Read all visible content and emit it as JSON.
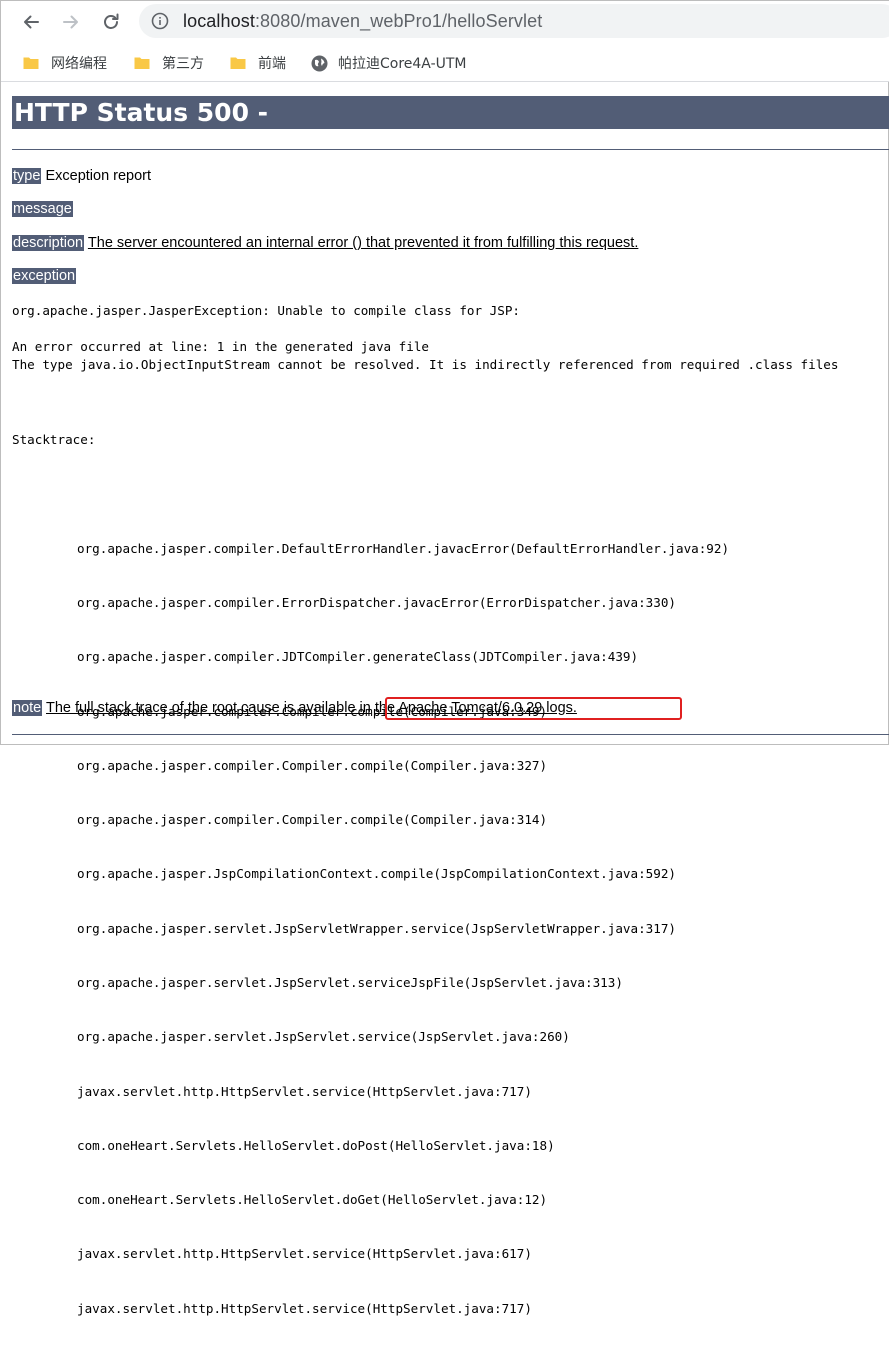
{
  "browser": {
    "url_host": "localhost",
    "url_rest": ":8080/maven_webPro1/helloServlet"
  },
  "bookmarks": [
    {
      "label": "网络编程",
      "icon": "folder-icon"
    },
    {
      "label": "第三方",
      "icon": "folder-icon"
    },
    {
      "label": "前端",
      "icon": "folder-icon"
    },
    {
      "label": "帕拉迪Core4A-UTM",
      "icon": "globe-icon"
    }
  ],
  "colors": {
    "tomcat_header": "#525d76",
    "highlight_box": "#e02020"
  },
  "page": {
    "title": "HTTP Status 500 -",
    "type_label": "type",
    "type_value": "Exception report",
    "message_label": "message",
    "description_label": "description",
    "description_value": "The server encountered an internal error () that prevented it from fulfilling this request.",
    "exception_label": "exception",
    "exception_line": "org.apache.jasper.JasperException: Unable to compile class for JSP:",
    "error_line1": "An error occurred at line: 1 in the generated java file",
    "error_line2": "The type java.io.ObjectInputStream cannot be resolved. It is indirectly referenced from required .class files",
    "stacktrace_label": "Stacktrace:",
    "stacktrace": [
      "org.apache.jasper.compiler.DefaultErrorHandler.javacError(DefaultErrorHandler.java:92)",
      "org.apache.jasper.compiler.ErrorDispatcher.javacError(ErrorDispatcher.java:330)",
      "org.apache.jasper.compiler.JDTCompiler.generateClass(JDTCompiler.java:439)",
      "org.apache.jasper.compiler.Compiler.compile(Compiler.java:349)",
      "org.apache.jasper.compiler.Compiler.compile(Compiler.java:327)",
      "org.apache.jasper.compiler.Compiler.compile(Compiler.java:314)",
      "org.apache.jasper.JspCompilationContext.compile(JspCompilationContext.java:592)",
      "org.apache.jasper.servlet.JspServletWrapper.service(JspServletWrapper.java:317)",
      "org.apache.jasper.servlet.JspServlet.serviceJspFile(JspServlet.java:313)",
      "org.apache.jasper.servlet.JspServlet.service(JspServlet.java:260)",
      "javax.servlet.http.HttpServlet.service(HttpServlet.java:717)",
      "com.oneHeart.Servlets.HelloServlet.doPost(HelloServlet.java:18)",
      "com.oneHeart.Servlets.HelloServlet.doGet(HelloServlet.java:12)",
      "javax.servlet.http.HttpServlet.service(HttpServlet.java:617)",
      "javax.servlet.http.HttpServlet.service(HttpServlet.java:717)"
    ],
    "note_label": "note",
    "note_text": "The full stack trace of the root cause is available in",
    "note_link": "the Apache Tomcat/6.0.29 logs."
  }
}
